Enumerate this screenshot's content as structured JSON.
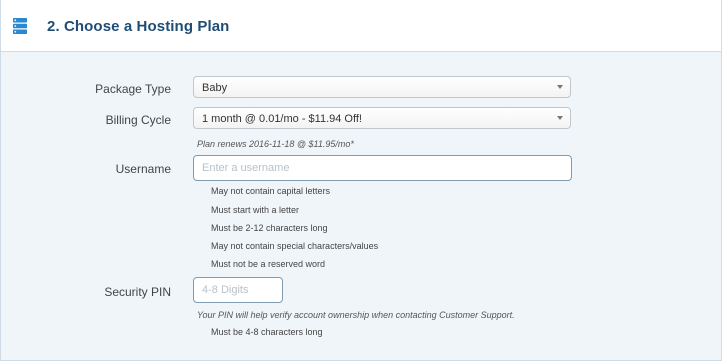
{
  "header": {
    "title": "2. Choose a Hosting Plan"
  },
  "package": {
    "label": "Package Type",
    "selected": "Baby"
  },
  "billing": {
    "label": "Billing Cycle",
    "selected": "1 month @ 0.01/mo - $11.94 Off!",
    "renew_note": "Plan renews 2016-11-18 @ $11.95/mo*"
  },
  "username": {
    "label": "Username",
    "placeholder": "Enter a username",
    "rules": [
      "May not contain capital letters",
      "Must start with a letter",
      "Must be 2-12 characters long",
      "May not contain special characters/values",
      "Must not be a reserved word"
    ]
  },
  "pin": {
    "label": "Security PIN",
    "placeholder": "4-8 Digits",
    "note": "Your PIN will help verify account ownership when contacting Customer Support.",
    "rules": [
      "Must be 4-8 characters long"
    ]
  },
  "icons": {
    "header_icon": "server-stack-icon",
    "select_caret": "chevron-down-icon"
  },
  "colors": {
    "header_title": "#1f4d75",
    "icon": "#2a87d0",
    "panel_bg": "#f0f5fa",
    "input_border": "#7f9cb3"
  }
}
